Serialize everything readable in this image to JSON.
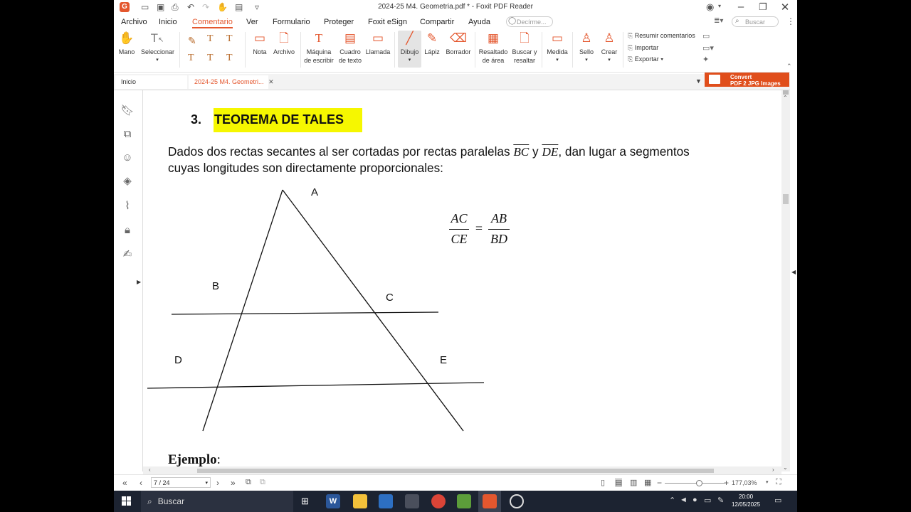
{
  "window": {
    "title": "2024-25 M4. Geometria.pdf * - Foxit PDF Reader",
    "app_logo": "G"
  },
  "menu": {
    "items": [
      "Archivo",
      "Inicio",
      "Comentario",
      "Ver",
      "Formulario",
      "Proteger",
      "Foxit eSign",
      "Compartir",
      "Ayuda"
    ],
    "active": "Comentario",
    "tell_me_placeholder": "Decírme...",
    "search_placeholder": "Buscar"
  },
  "ribbon": {
    "mano": "Mano",
    "seleccionar": "Seleccionar",
    "nota": "Nota",
    "archivo": "Archivo",
    "maquina_1": "Máquina",
    "maquina_2": "de escribir",
    "cuadro_1": "Cuadro",
    "cuadro_2": "de texto",
    "llamada": "Llamada",
    "dibujo": "Dibujo",
    "lapiz": "Lápiz",
    "borrador": "Borrador",
    "resaltado_1": "Resaltado",
    "resaltado_2": "de área",
    "buscar_1": "Buscar y",
    "buscar_2": "resaltar",
    "medida": "Medida",
    "sello": "Sello",
    "crear": "Crear",
    "resumir": "Resumir comentarios",
    "importar": "Importar",
    "exportar": "Exportar"
  },
  "tabs": {
    "home": "Inicio",
    "doc": "2024-25 M4. Geometri..."
  },
  "convert": {
    "line1": "Convert",
    "line2": "PDF 2 JPG Images"
  },
  "document": {
    "heading_number": "3.",
    "heading_text": "TEOREMA DE TALES",
    "para1_a": "Dados dos rectas secantes al ser cortadas por rectas paralelas ",
    "bc": "BC",
    "y": " y ",
    "de": "DE",
    "para1_b": ", dan lugar a segmentos",
    "para2": "cuyas longitudes son directamente proporcionales:",
    "formula": {
      "num1": "AC",
      "den1": "CE",
      "eq": "=",
      "num2": "AB",
      "den2": "BD"
    },
    "labels": {
      "a": "A",
      "b": "B",
      "c": "C",
      "d": "D",
      "e": "E"
    },
    "ejemplo": "Ejemplo",
    "ejemplo_colon": ":"
  },
  "status": {
    "page": "7 / 24",
    "zoom": "177,03%"
  },
  "taskbar": {
    "search": "Buscar",
    "time": "20:00",
    "date": "12/05/2025"
  },
  "colors": {
    "accent": "#e4572e",
    "highlight": "#f6f700",
    "convert": "#e04e1b",
    "taskbar": "#1c2331"
  }
}
